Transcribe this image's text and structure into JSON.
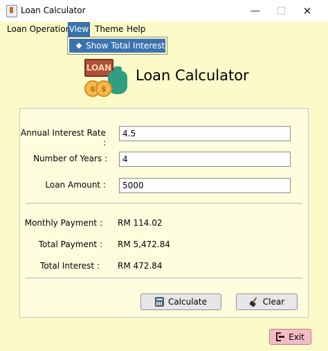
{
  "window": {
    "title": "Loan Calculator"
  },
  "menubar": {
    "items": [
      {
        "label": "Loan Operation"
      },
      {
        "label": "View"
      },
      {
        "label": "Theme"
      },
      {
        "label": "Help"
      }
    ],
    "open_menu": "View",
    "dropdown": {
      "items": [
        {
          "label": "Show Total Interest",
          "selected": true
        }
      ]
    }
  },
  "header": {
    "logo": {
      "sign_text": "LOAN",
      "coin_symbol": "$"
    },
    "title": "Loan Calculator"
  },
  "form": {
    "interest": {
      "label": "Annual Interest Rate :",
      "value": "4.5"
    },
    "years": {
      "label": "Number of Years :",
      "value": "4"
    },
    "amount": {
      "label": "Loan Amount :",
      "value": "5000"
    }
  },
  "results": {
    "monthly": {
      "label": "Monthly Payment :",
      "value": "RM 114.02"
    },
    "total": {
      "label": "Total Payment :",
      "value": "RM 5,472.84"
    },
    "interest": {
      "label": "Total Interest :",
      "value": "RM 472.84"
    }
  },
  "buttons": {
    "calculate": {
      "label": "Calculate",
      "icon": "calculator-icon"
    },
    "clear": {
      "label": "Clear",
      "icon": "broom-icon"
    },
    "exit": {
      "label": "Exit",
      "icon": "exit-door-icon"
    }
  },
  "colors": {
    "background": "#fcfac8",
    "menu_highlight": "#3b73b0",
    "exit_button": "#f4bcc6"
  }
}
